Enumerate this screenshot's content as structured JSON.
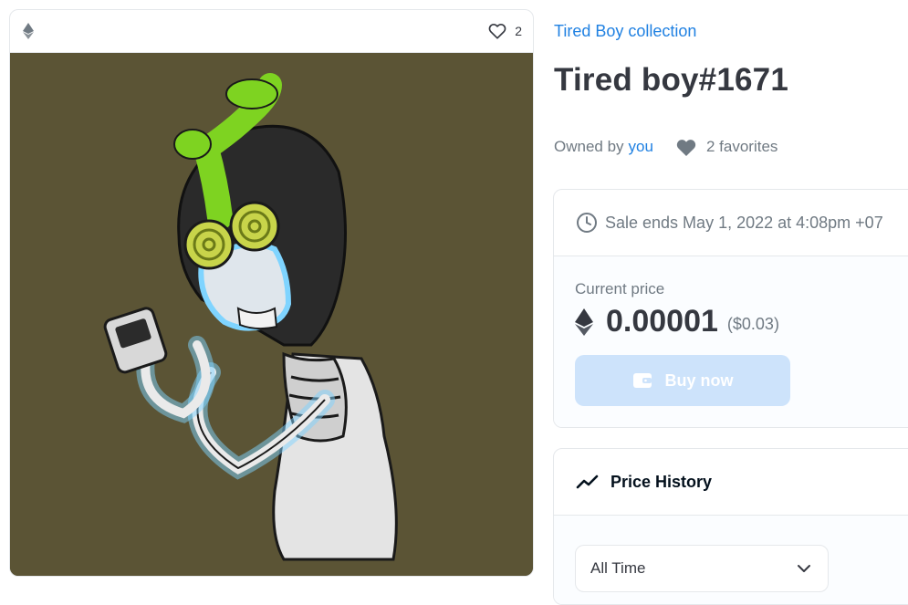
{
  "media": {
    "favorite_count": "2",
    "icons": {
      "chain": "ethereum-icon",
      "favorite": "heart-outline-icon"
    }
  },
  "collection": {
    "name": "Tired Boy collection"
  },
  "item": {
    "title": "Tired boy#1671"
  },
  "owner": {
    "prefix": "Owned by",
    "name": "you"
  },
  "favorites": {
    "label": "2 favorites"
  },
  "sale": {
    "ends_text": "Sale ends May 1, 2022 at 4:08pm +07",
    "current_price_label": "Current price",
    "price": "0.00001",
    "price_usd": "($0.03)",
    "buy_label": "Buy now"
  },
  "price_history": {
    "title": "Price History",
    "range_selected": "All Time"
  },
  "colors": {
    "accent": "#2081e2",
    "artwork_bg": "#5b5435",
    "buy_disabled": "#cde3fb"
  }
}
